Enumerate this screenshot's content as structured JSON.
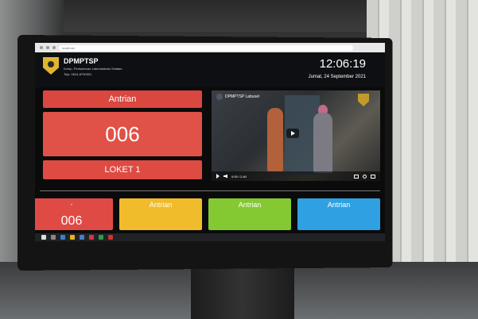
{
  "header": {
    "org_name": "DPMPTSP",
    "org_address": "Komp. Perkantoran Labuhanbatu Selatan",
    "org_phone": "Telp. 0624-8790001",
    "clock": "12:06:19",
    "date": "Jumat, 24 September 2021"
  },
  "main_call": {
    "queue_label": "Antrian",
    "queue_number": "006",
    "counter_label": "LOKET 1"
  },
  "video": {
    "channel_title": "DPMPTSP Labusel",
    "time_readout": "0:00 / 2:40"
  },
  "counters": [
    {
      "title": "-",
      "number": "006",
      "color": "#e04a45"
    },
    {
      "title": "Antrian",
      "color": "#f0bc2c"
    },
    {
      "title": "Antrian",
      "color": "#85c932"
    },
    {
      "title": "Antrian",
      "color": "#2fa1e2"
    }
  ],
  "browser": {
    "url": "localhost"
  }
}
